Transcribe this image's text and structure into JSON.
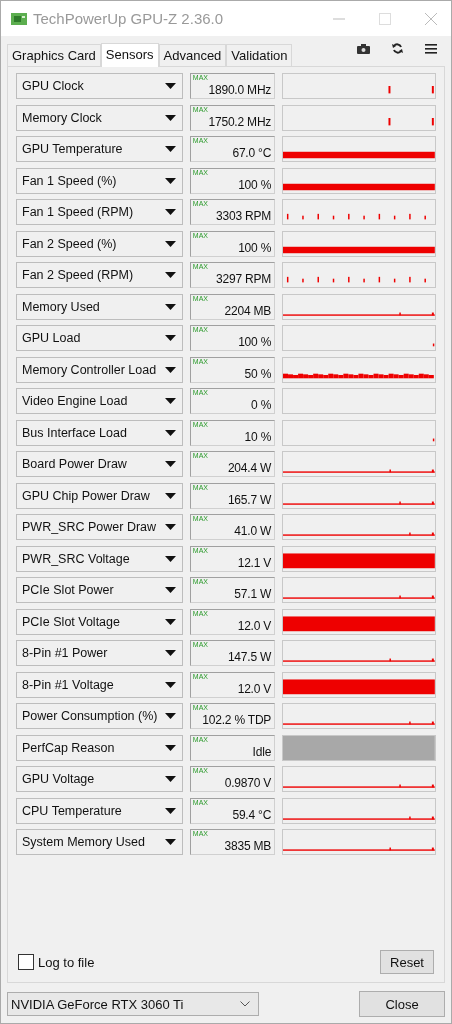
{
  "window": {
    "title": "TechPowerUp GPU-Z 2.36.0"
  },
  "tabs": [
    {
      "label": "Graphics Card",
      "selected": false
    },
    {
      "label": "Sensors",
      "selected": true
    },
    {
      "label": "Advanced",
      "selected": false
    },
    {
      "label": "Validation",
      "selected": false
    }
  ],
  "sensors": [
    {
      "name": "GPU Clock",
      "max": "MAX",
      "value": "1890.0 MHz",
      "kind": "spikes"
    },
    {
      "name": "Memory Clock",
      "max": "MAX",
      "value": "1750.2 MHz",
      "kind": "spikes"
    },
    {
      "name": "GPU Temperature",
      "max": "MAX",
      "value": "67.0 °C",
      "kind": "full"
    },
    {
      "name": "Fan 1 Speed (%)",
      "max": "MAX",
      "value": "100 %",
      "kind": "full"
    },
    {
      "name": "Fan 1 Speed (RPM)",
      "max": "MAX",
      "value": "3303 RPM",
      "kind": "ticks"
    },
    {
      "name": "Fan 2 Speed (%)",
      "max": "MAX",
      "value": "100 %",
      "kind": "full"
    },
    {
      "name": "Fan 2 Speed (RPM)",
      "max": "MAX",
      "value": "3297 RPM",
      "kind": "ticks"
    },
    {
      "name": "Memory Used",
      "max": "MAX",
      "value": "2204 MB",
      "kind": "line"
    },
    {
      "name": "GPU Load",
      "max": "MAX",
      "value": "100 %",
      "kind": "empty"
    },
    {
      "name": "Memory Controller Load",
      "max": "MAX",
      "value": "50 %",
      "kind": "noise"
    },
    {
      "name": "Video Engine Load",
      "max": "MAX",
      "value": "0 %",
      "kind": "empty"
    },
    {
      "name": "Bus Interface Load",
      "max": "MAX",
      "value": "10 %",
      "kind": "empty"
    },
    {
      "name": "Board Power Draw",
      "max": "MAX",
      "value": "204.4 W",
      "kind": "line"
    },
    {
      "name": "GPU Chip Power Draw",
      "max": "MAX",
      "value": "165.7 W",
      "kind": "line"
    },
    {
      "name": "PWR_SRC Power Draw",
      "max": "MAX",
      "value": "41.0 W",
      "kind": "line"
    },
    {
      "name": "PWR_SRC Voltage",
      "max": "MAX",
      "value": "12.1 V",
      "kind": "high"
    },
    {
      "name": "PCIe Slot Power",
      "max": "MAX",
      "value": "57.1 W",
      "kind": "line"
    },
    {
      "name": "PCIe Slot Voltage",
      "max": "MAX",
      "value": "12.0 V",
      "kind": "high"
    },
    {
      "name": "8-Pin #1 Power",
      "max": "MAX",
      "value": "147.5 W",
      "kind": "line"
    },
    {
      "name": "8-Pin #1 Voltage",
      "max": "MAX",
      "value": "12.0 V",
      "kind": "high"
    },
    {
      "name": "Power Consumption (%)",
      "max": "MAX",
      "value": "102.2 % TDP",
      "kind": "line"
    },
    {
      "name": "PerfCap Reason",
      "max": "MAX",
      "value": "Idle",
      "kind": "grey"
    },
    {
      "name": "GPU Voltage",
      "max": "MAX",
      "value": "0.9870 V",
      "kind": "line"
    },
    {
      "name": "CPU Temperature",
      "max": "MAX",
      "value": "59.4 °C",
      "kind": "line"
    },
    {
      "name": "System Memory Used",
      "max": "MAX",
      "value": "3835 MB",
      "kind": "line"
    }
  ],
  "log_to_file": {
    "label": "Log to file",
    "checked": false
  },
  "reset_button": "Reset",
  "device": "NVIDIA GeForce RTX 3060 Ti",
  "close_button": "Close"
}
